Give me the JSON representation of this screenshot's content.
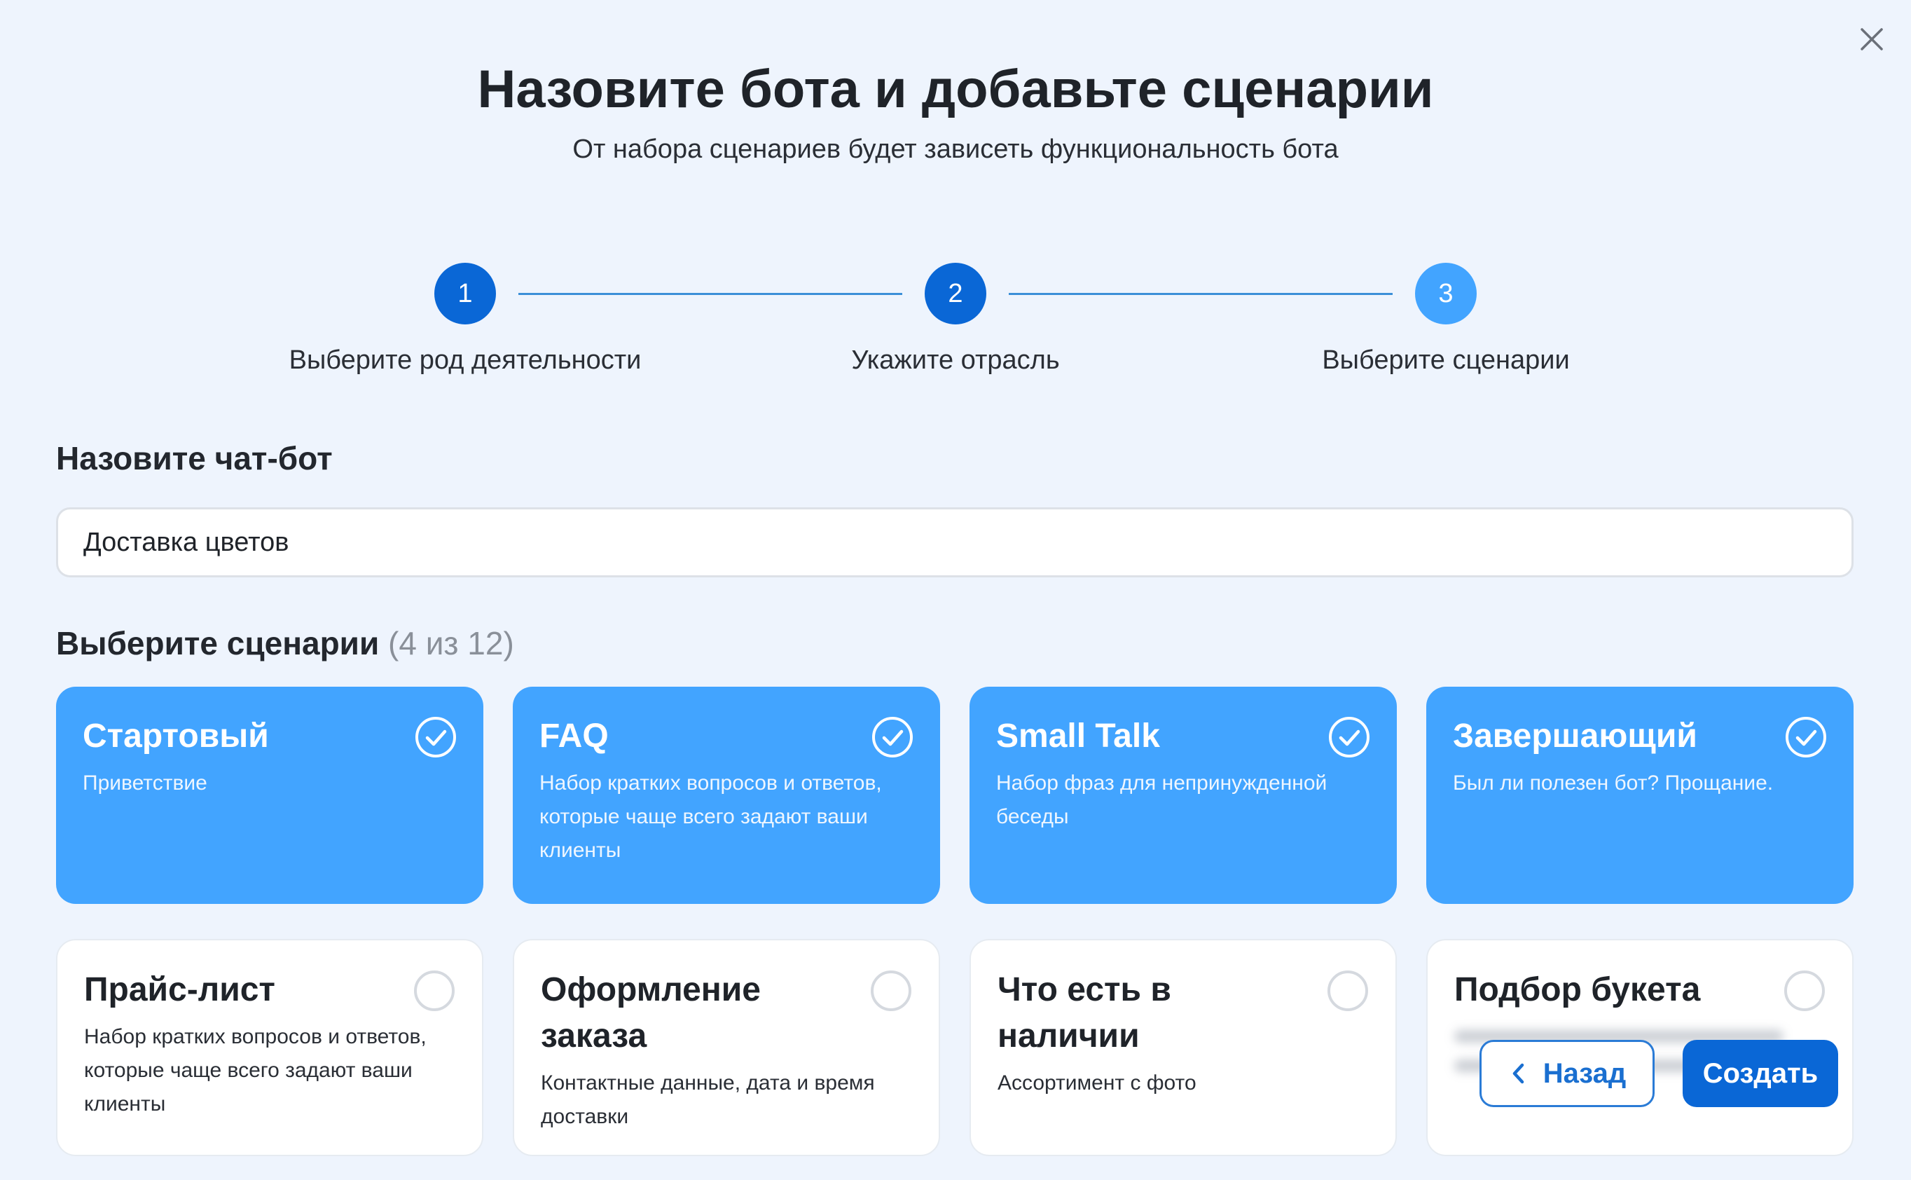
{
  "header": {
    "title": "Назовите бота и добавьте сценарии",
    "subtitle": "От набора сценариев будет зависеть функциональность бота"
  },
  "stepper": {
    "steps": [
      {
        "number": "1",
        "label": "Выберите род деятельности",
        "state": "done"
      },
      {
        "number": "2",
        "label": "Укажите отрасль",
        "state": "done"
      },
      {
        "number": "3",
        "label": "Выберите сценарии",
        "state": "current"
      }
    ]
  },
  "name_section": {
    "label": "Назовите чат-бот",
    "value": "Доставка цветов"
  },
  "scenarios": {
    "label": "Выберите сценарии",
    "count": "(4 из 12)",
    "cards": [
      {
        "title": "Стартовый",
        "description": "Приветствие",
        "selected": true
      },
      {
        "title": "FAQ",
        "description": "Набор кратких вопросов и ответов, которые чаще всего задают ваши клиенты",
        "selected": true
      },
      {
        "title": "Small Talk",
        "description": "Набор фраз для непринужденной беседы",
        "selected": true
      },
      {
        "title": "Завершающий",
        "description": "Был ли полезен бот? Прощание.",
        "selected": true
      },
      {
        "title": "Прайс-лист",
        "description": "Набор кратких вопросов и ответов, которые чаще всего задают ваши клиенты",
        "selected": false
      },
      {
        "title": "Оформление заказа",
        "description": "Контактные данные, дата и время доставки",
        "selected": false
      },
      {
        "title": "Что есть в наличии",
        "description": "Ассортимент с фото",
        "selected": false
      },
      {
        "title": "Подбор букета",
        "description": "",
        "selected": false
      }
    ]
  },
  "footer": {
    "back_label": "Назад",
    "create_label": "Создать"
  },
  "colors": {
    "background": "#eef4fd",
    "primary": "#0a67d6",
    "selected_card": "#42a4ff",
    "step_line": "#3c8fd8"
  },
  "icons": {
    "close": "close-icon",
    "check": "check-circle-icon",
    "radio": "radio-empty-icon",
    "back": "chevron-left-icon"
  }
}
